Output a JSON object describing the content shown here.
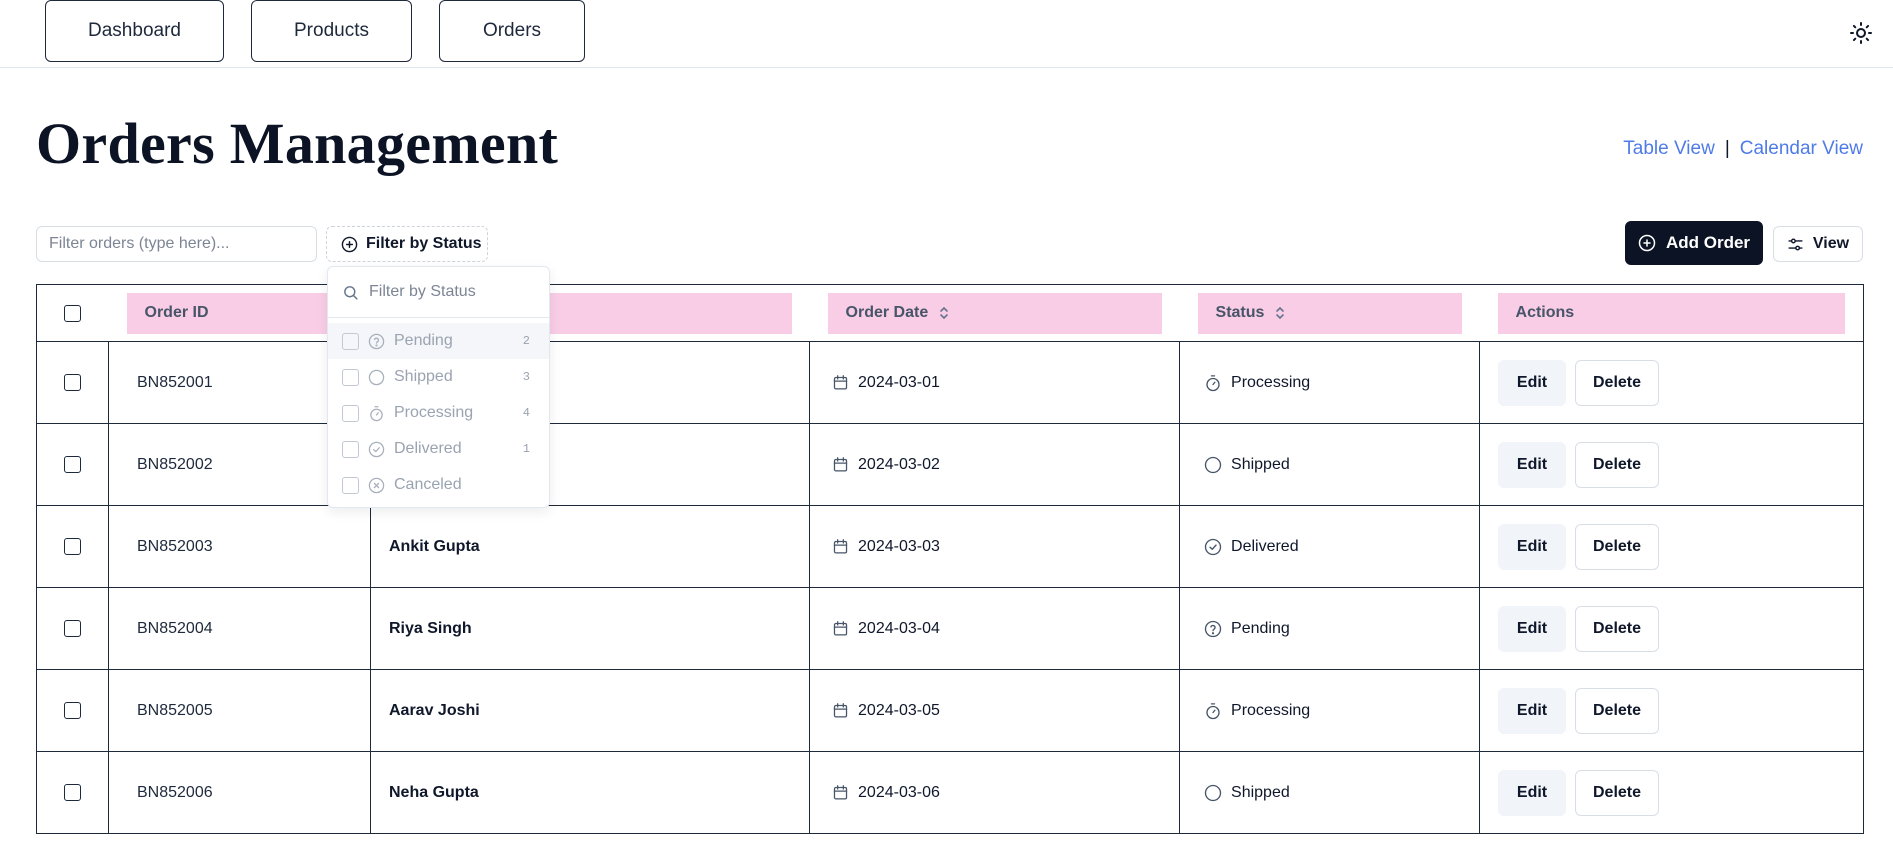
{
  "nav": {
    "items": [
      {
        "label": "Dashboard"
      },
      {
        "label": "Products"
      },
      {
        "label": "Orders"
      }
    ]
  },
  "icons": {
    "theme": "sun-icon"
  },
  "page": {
    "title": "Orders Management"
  },
  "views": {
    "table": "Table View",
    "separator": "|",
    "calendar": "Calendar View"
  },
  "toolbar": {
    "filter_placeholder": "Filter orders (type here)...",
    "status_filter_label": "Filter by Status",
    "add_order_label": "Add Order",
    "view_label": "View"
  },
  "status_popover": {
    "search_placeholder": "Filter by Status",
    "options": [
      {
        "label": "Pending",
        "count": "2",
        "icon": "question-circle-icon"
      },
      {
        "label": "Shipped",
        "count": "3",
        "icon": "circle-icon"
      },
      {
        "label": "Processing",
        "count": "4",
        "icon": "timer-icon"
      },
      {
        "label": "Delivered",
        "count": "1",
        "icon": "check-circle-icon"
      },
      {
        "label": "Canceled",
        "count": "",
        "icon": "x-circle-icon"
      }
    ]
  },
  "table": {
    "columns": {
      "order_id": "Order ID",
      "order_date": "Order Date",
      "status": "Status",
      "actions": "Actions"
    },
    "edit_label": "Edit",
    "delete_label": "Delete",
    "rows": [
      {
        "id": "BN852001",
        "customer": "",
        "date": "2024-03-01",
        "status": "Processing"
      },
      {
        "id": "BN852002",
        "customer": "",
        "date": "2024-03-02",
        "status": "Shipped"
      },
      {
        "id": "BN852003",
        "customer": "Ankit Gupta",
        "date": "2024-03-03",
        "status": "Delivered"
      },
      {
        "id": "BN852004",
        "customer": "Riya Singh",
        "date": "2024-03-04",
        "status": "Pending"
      },
      {
        "id": "BN852005",
        "customer": "Aarav Joshi",
        "date": "2024-03-05",
        "status": "Processing"
      },
      {
        "id": "BN852006",
        "customer": "Neha Gupta",
        "date": "2024-03-06",
        "status": "Shipped"
      }
    ]
  },
  "colors": {
    "header_pink": "#f9cde6",
    "primary": "#0b1324",
    "link": "#4f7be8"
  }
}
